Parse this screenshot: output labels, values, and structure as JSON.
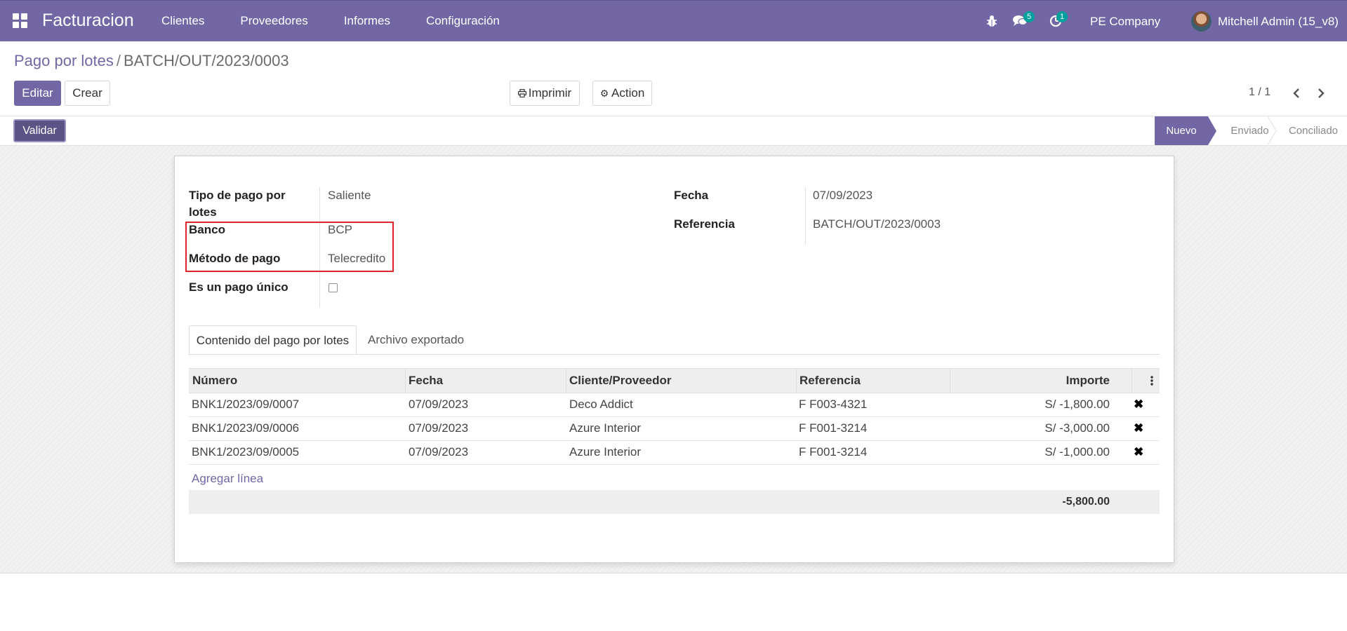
{
  "navbar": {
    "app_name": "Facturacion",
    "menu": [
      "Clientes",
      "Proveedores",
      "Informes",
      "Configuración"
    ],
    "icons": {
      "apps": "apps-grid-icon",
      "debug": "bug-icon",
      "messages": "chat-icon",
      "activities": "clock-icon"
    },
    "messages_count": "5",
    "activities_count": "1",
    "company": "PE Company",
    "user": "Mitchell Admin (15_v8)"
  },
  "breadcrumb": {
    "parent": "Pago por lotes",
    "separator": "/",
    "current": "BATCH/OUT/2023/0003"
  },
  "actions": {
    "edit": "Editar",
    "create": "Crear",
    "print": "Imprimir",
    "action": "Action",
    "pager": "1 / 1"
  },
  "statusbar": {
    "validate": "Validar",
    "stages": [
      {
        "label": "Nuevo",
        "active": true
      },
      {
        "label": "Enviado",
        "active": false
      },
      {
        "label": "Conciliado",
        "active": false
      }
    ]
  },
  "form": {
    "batch_type_label_line1": "Tipo de pago por",
    "batch_type_label_line2": "lotes",
    "batch_type_value": "Saliente",
    "bank_label": "Banco",
    "bank_value": "BCP",
    "payment_method_label": "Método de pago",
    "payment_method_value": "Telecredito",
    "unique_payment_label": "Es un pago único",
    "unique_payment_checked": false,
    "date_label": "Fecha",
    "date_value": "07/09/2023",
    "reference_label": "Referencia",
    "reference_value": "BATCH/OUT/2023/0003"
  },
  "tabs": [
    "Contenido del pago por lotes",
    "Archivo exportado"
  ],
  "table": {
    "columns": [
      "Número",
      "Fecha",
      "Cliente/Proveedor",
      "Referencia",
      "Importe"
    ],
    "rows": [
      {
        "number": "BNK1/2023/09/0007",
        "date": "07/09/2023",
        "partner": "Deco Addict",
        "ref": "F F003-4321",
        "amount": "S/ -1,800.00"
      },
      {
        "number": "BNK1/2023/09/0006",
        "date": "07/09/2023",
        "partner": "Azure Interior",
        "ref": "F F001-3214",
        "amount": "S/ -3,000.00"
      },
      {
        "number": "BNK1/2023/09/0005",
        "date": "07/09/2023",
        "partner": "Azure Interior",
        "ref": "F F001-3214",
        "amount": "S/ -1,000.00"
      }
    ],
    "add_line": "Agregar línea",
    "total": "-5,800.00"
  },
  "colors": {
    "brand": "#7267a4",
    "annotation": "#e0242c"
  }
}
